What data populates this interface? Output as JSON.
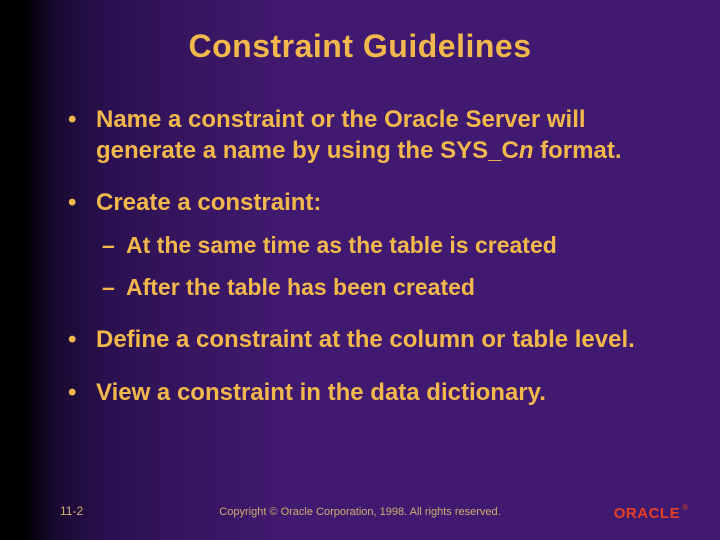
{
  "title": "Constraint Guidelines",
  "bullets": {
    "b1_pre": "Name a constraint or the Oracle Server will generate a name by using the SYS_C",
    "b1_italic": "n",
    "b1_post": " format.",
    "b2": "Create a constraint:",
    "b2s1": "At the same time as the table is created",
    "b2s2": "After the table has been created",
    "b3": "Define a constraint at the column or table level.",
    "b4": "View a constraint in the data dictionary."
  },
  "footer": {
    "slide_number": "11-2",
    "copyright": "Copyright © Oracle Corporation, 1998. All rights reserved.",
    "logo_text": "ORACLE",
    "logo_reg": "®"
  },
  "glyphs": {
    "dot": "•",
    "dash": "–"
  }
}
